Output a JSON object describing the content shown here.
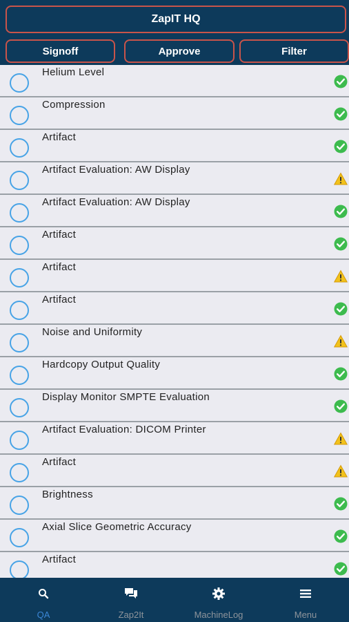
{
  "header": {
    "title": "ZapIT HQ",
    "actions": {
      "signoff": "Signoff",
      "approve": "Approve",
      "filter": "Filter"
    }
  },
  "items": [
    {
      "label": "Helium Level",
      "status": "ok"
    },
    {
      "label": "Compression",
      "status": "ok"
    },
    {
      "label": "Artifact",
      "status": "ok"
    },
    {
      "label": "Artifact Evaluation: AW Display",
      "status": "warning"
    },
    {
      "label": "Artifact Evaluation: AW Display",
      "status": "ok"
    },
    {
      "label": "Artifact",
      "status": "ok"
    },
    {
      "label": "Artifact",
      "status": "warning"
    },
    {
      "label": "Artifact",
      "status": "ok"
    },
    {
      "label": "Noise and Uniformity",
      "status": "warning"
    },
    {
      "label": "Hardcopy Output Quality",
      "status": "ok"
    },
    {
      "label": "Display Monitor SMPTE Evaluation",
      "status": "ok"
    },
    {
      "label": "Artifact Evaluation: DICOM Printer",
      "status": "warning"
    },
    {
      "label": "Artifact",
      "status": "warning"
    },
    {
      "label": "Brightness",
      "status": "ok"
    },
    {
      "label": "Axial Slice Geometric Accuracy",
      "status": "ok"
    },
    {
      "label": "Artifact",
      "status": "ok"
    }
  ],
  "tabs": [
    {
      "label": "QA",
      "icon": "search-icon",
      "active": true
    },
    {
      "label": "Zap2It",
      "icon": "chat-icon",
      "active": false
    },
    {
      "label": "MachineLog",
      "icon": "gear-icon",
      "active": false
    },
    {
      "label": "Menu",
      "icon": "menu-icon",
      "active": false
    }
  ],
  "colors": {
    "navy": "#0d3a5b",
    "button_border": "#c9544a",
    "ok": "#3dbb4e",
    "warning": "#f2c21b",
    "radio": "#47a3e6",
    "active_tab": "#3b86d6"
  }
}
